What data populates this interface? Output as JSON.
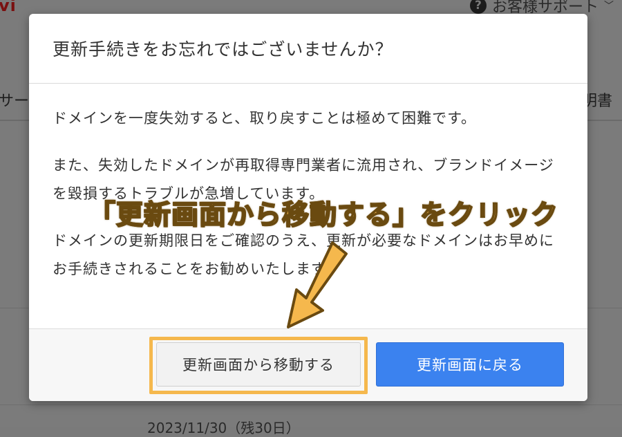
{
  "background": {
    "logo_fragment": "vi",
    "support_label": "お客様サポート",
    "nav_left_fragment": "サーバ",
    "nav_right_fragment": "明書",
    "bottom_fragment": "2023/11/30（残30日）"
  },
  "modal": {
    "title": "更新手続きをお忘れではございませんか？",
    "paragraphs": [
      "ドメインを一度失効すると、取り戻すことは極めて困難です。",
      "また、失効したドメインが再取得専門業者に流用され、ブランドイメージを毀損するトラブルが急増しています。",
      "ドメインの更新期限日をご確認のうえ、更新が必要なドメインはお早めにお手続きされることをお勧めいたします。"
    ],
    "buttons": {
      "leave_label": "更新画面から移動する",
      "back_label": "更新画面に戻る"
    }
  },
  "annotation": {
    "text": "「更新画面から移動する」をクリック",
    "color": "#f5b84d"
  },
  "colors": {
    "primary_button": "#3b82ef",
    "highlight": "#f5b84d"
  }
}
